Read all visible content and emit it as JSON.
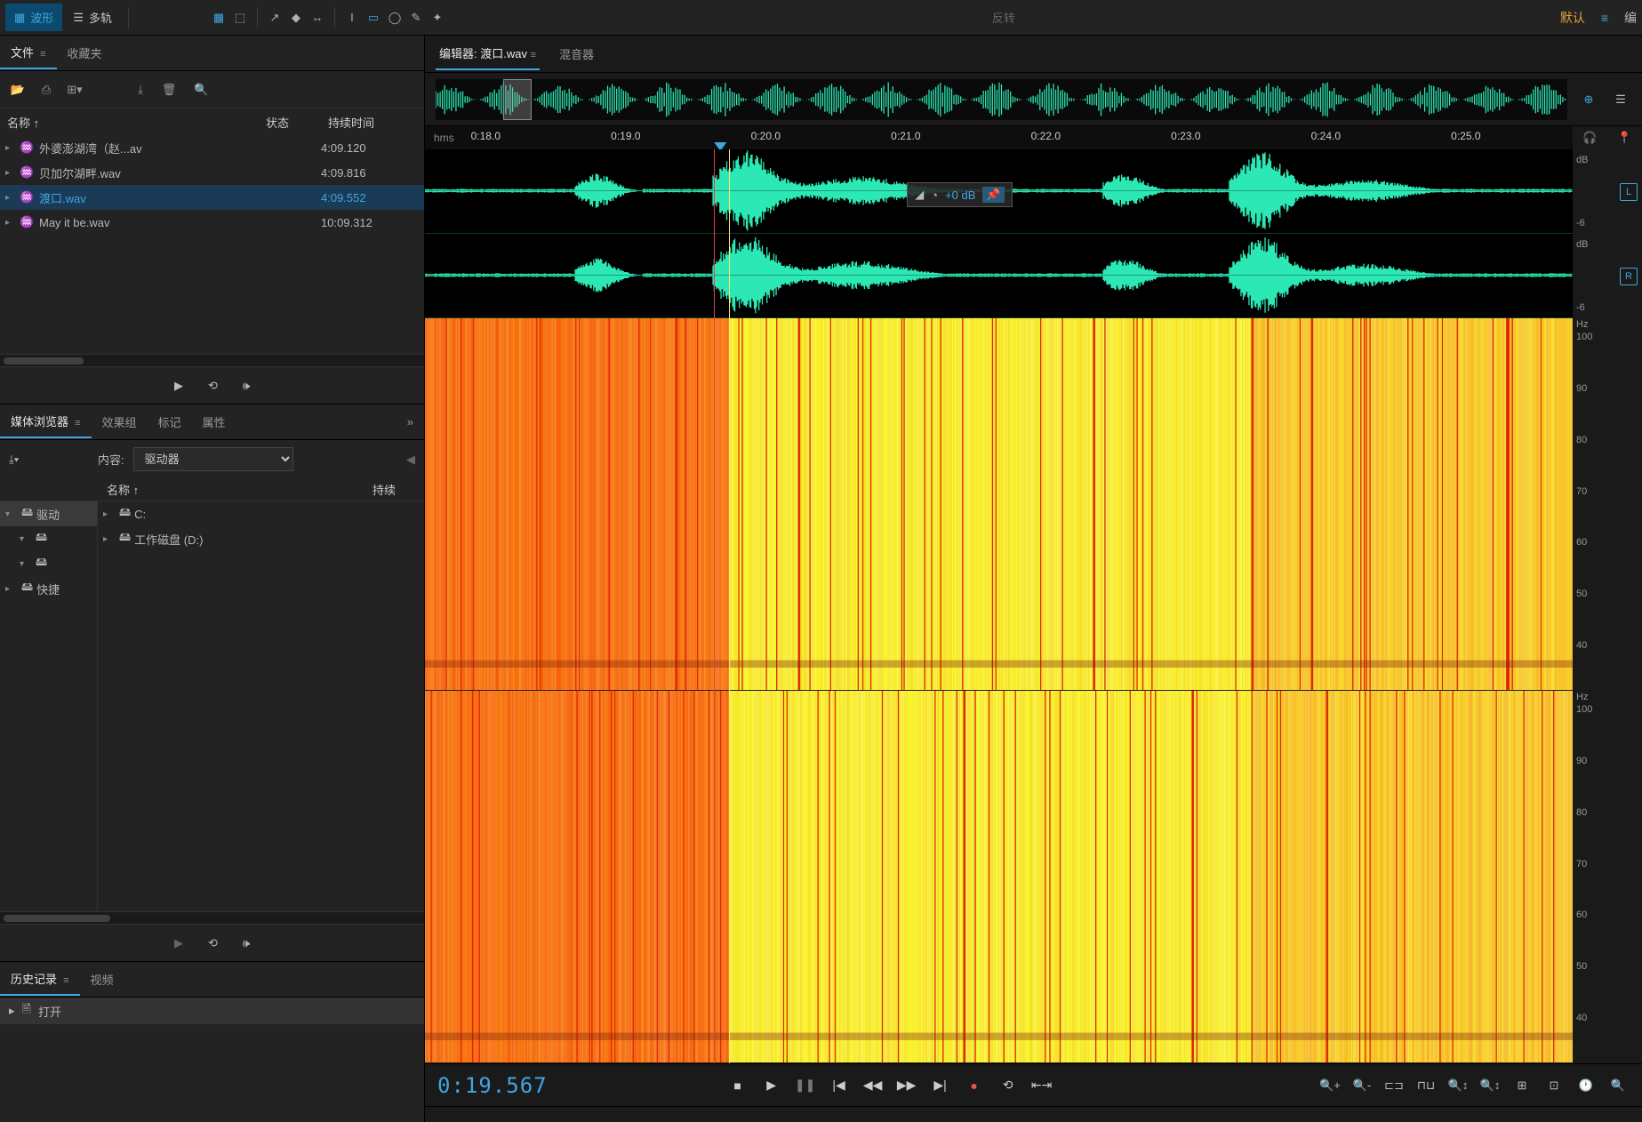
{
  "top": {
    "waveform": "波形",
    "multitrack": "多轨",
    "center_disabled": "反转",
    "default": "默认",
    "edit": "编"
  },
  "files": {
    "tab_file": "文件",
    "tab_fav": "收藏夹",
    "col_name": "名称 ↑",
    "col_status": "状态",
    "col_duration": "持续时间",
    "search_placeholder": "",
    "items": [
      {
        "name": "外婆澎湖湾（赵...av",
        "duration": "4:09.120"
      },
      {
        "name": "贝加尔湖畔.wav",
        "duration": "4:09.816"
      },
      {
        "name": "渡口.wav",
        "duration": "4:09.552"
      },
      {
        "name": "May it be.wav",
        "duration": "10:09.312"
      }
    ],
    "selected_index": 2
  },
  "media": {
    "tab_browser": "媒体浏览器",
    "tab_effects": "效果组",
    "tab_markers": "标记",
    "tab_props": "属性",
    "content_label": "内容:",
    "content_value": "驱动器",
    "col_name": "名称 ↑",
    "col_dur": "持续",
    "left_tree": [
      {
        "label": "驱动",
        "selected": true
      },
      {
        "label": "",
        "indent": 1
      },
      {
        "label": "",
        "indent": 1
      },
      {
        "label": "快捷",
        "indent": 0
      }
    ],
    "right_tree": [
      {
        "label": "C:"
      },
      {
        "label": "工作磁盘 (D:)"
      }
    ]
  },
  "history": {
    "tab_history": "历史记录",
    "tab_video": "视频",
    "item_open": "打开"
  },
  "editor": {
    "tab_editor": "编辑器: 渡口.wav",
    "tab_mixer": "混音器",
    "hms": "hms",
    "ticks": [
      "0:18.0",
      "0:19.0",
      "0:20.0",
      "0:21.0",
      "0:22.0",
      "0:23.0",
      "0:24.0",
      "0:25.0"
    ],
    "hud_db": "+0 dB",
    "db_label": "dB",
    "db_minus6": "-6",
    "hz_label": "Hz",
    "hz_ticks_top": [
      "100",
      "90",
      "80",
      "70",
      "60",
      "50",
      "40"
    ],
    "ch_L": "L",
    "ch_R": "R",
    "timecode": "0:19.567"
  }
}
